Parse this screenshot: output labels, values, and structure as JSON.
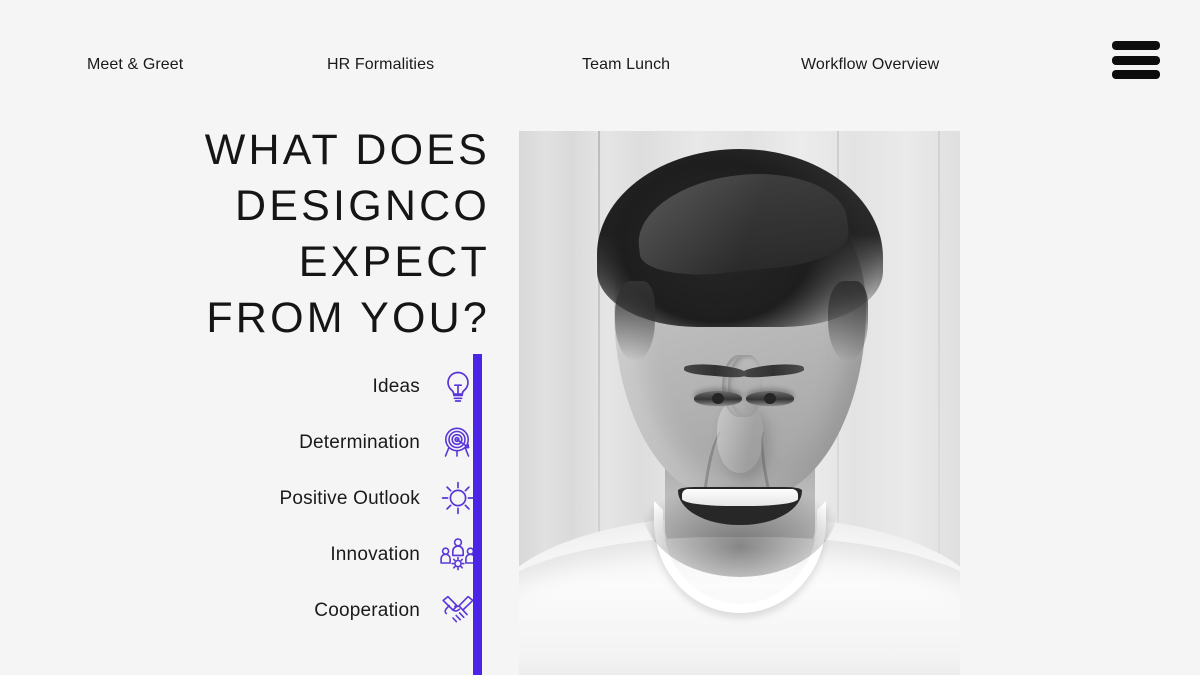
{
  "page": {
    "background_color": "#f5f5f5",
    "accent_color": "#4b24e8",
    "text_color": "#1a1a1a"
  },
  "nav": {
    "items": [
      {
        "label": "Meet & Greet"
      },
      {
        "label": "HR Formalities"
      },
      {
        "label": "Team Lunch"
      },
      {
        "label": "Workflow Overview"
      }
    ],
    "menu_icon": "hamburger-menu-icon"
  },
  "hero": {
    "headline": "WHAT DOES\nDESIGNCO\nEXPECT\nFROM YOU?",
    "image": {
      "alt": "black and white portrait of a smiling man in a white t-shirt",
      "filter": "grayscale"
    }
  },
  "values": {
    "items": [
      {
        "label": "Ideas",
        "icon": "lightbulb-icon"
      },
      {
        "label": "Determination",
        "icon": "target-icon"
      },
      {
        "label": "Positive Outlook",
        "icon": "sun-icon"
      },
      {
        "label": "Innovation",
        "icon": "team-gear-icon"
      },
      {
        "label": "Cooperation",
        "icon": "handshake-icon"
      }
    ]
  }
}
